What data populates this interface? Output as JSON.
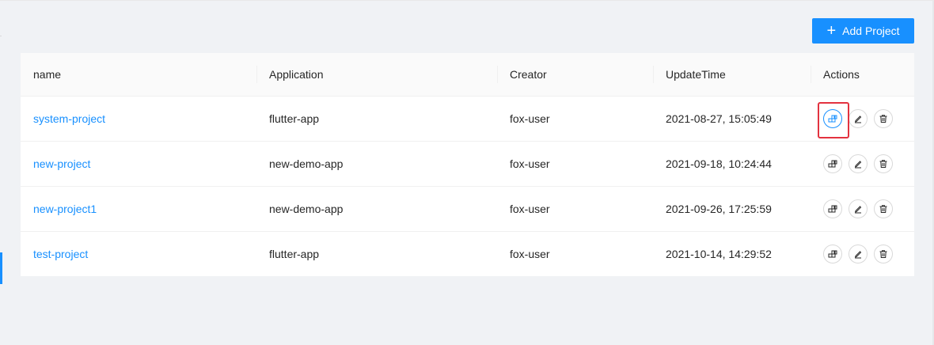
{
  "toolbar": {
    "add_button_label": "Add Project",
    "add_button_icon": "plus-icon"
  },
  "colors": {
    "primary": "#1890ff",
    "highlight": "#e3323f",
    "page_background": "#f0f2f5"
  },
  "table": {
    "columns": [
      "name",
      "Application",
      "Creator",
      "UpdateTime",
      "Actions"
    ],
    "rows": [
      {
        "name": "system-project",
        "application": "flutter-app",
        "creator": "fox-user",
        "update_time": "2021-08-27, 15:05:49"
      },
      {
        "name": "new-project",
        "application": "new-demo-app",
        "creator": "fox-user",
        "update_time": "2021-09-18, 10:24:44"
      },
      {
        "name": "new-project1",
        "application": "new-demo-app",
        "creator": "fox-user",
        "update_time": "2021-09-26, 17:25:59"
      },
      {
        "name": "test-project",
        "application": "flutter-app",
        "creator": "fox-user",
        "update_time": "2021-10-14, 14:29:52"
      }
    ],
    "row_actions": [
      "deploy-icon",
      "edit-icon",
      "delete-icon"
    ],
    "highlighted_action": "deploy-icon on row 1"
  }
}
